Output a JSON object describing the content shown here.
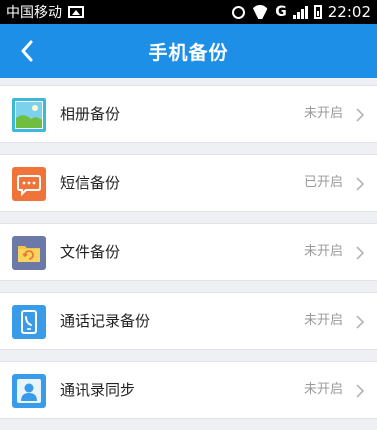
{
  "status_bar": {
    "carrier": "中国移动",
    "network": "G",
    "time": "22:02"
  },
  "header": {
    "title": "手机备份",
    "color": "#1e8fe6"
  },
  "items": [
    {
      "label": "相册备份",
      "status": "未开启",
      "icon": "photo-album-icon",
      "color": "#3cb9d8"
    },
    {
      "label": "短信备份",
      "status": "已开启",
      "icon": "sms-icon",
      "color": "#f0743a"
    },
    {
      "label": "文件备份",
      "status": "未开启",
      "icon": "folder-icon",
      "color": "#6b78a8"
    },
    {
      "label": "通话记录备份",
      "status": "未开启",
      "icon": "call-log-icon",
      "color": "#3a9be8"
    },
    {
      "label": "通讯录同步",
      "status": "未开启",
      "icon": "contacts-icon",
      "color": "#3a9be8"
    }
  ]
}
